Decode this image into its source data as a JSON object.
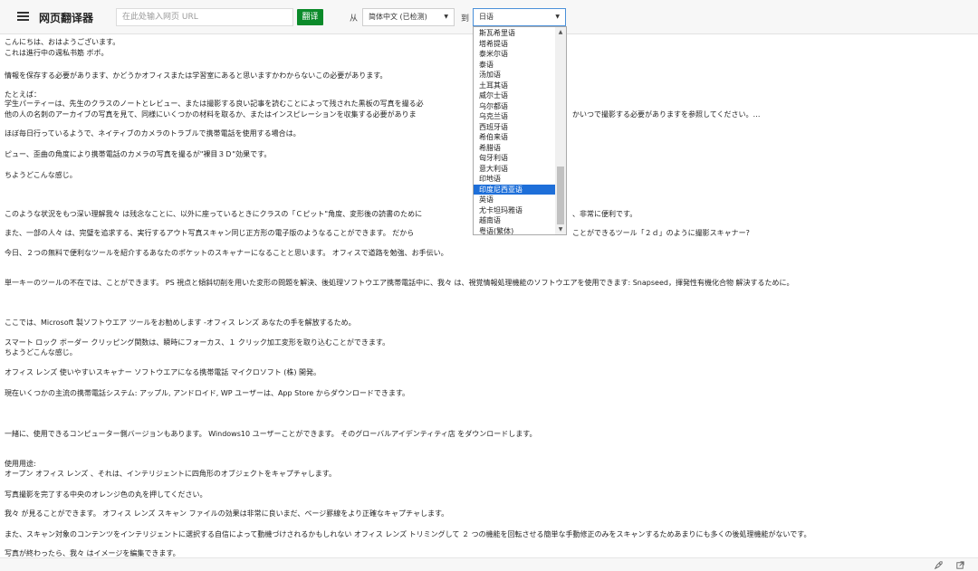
{
  "header": {
    "app_title": "网页翻译器",
    "url_placeholder": "在此处输入网页 URL",
    "translate_label": "翻译",
    "from_label": "从",
    "from_value": "简体中文 (已检测)",
    "to_label": "到",
    "to_value": "日语"
  },
  "dropdown": {
    "options": [
      "斯瓦希里语",
      "塔希提语",
      "泰米尔语",
      "泰语",
      "汤加语",
      "土耳其语",
      "威尔士语",
      "乌尔都语",
      "乌克兰语",
      "西班牙语",
      "希伯来语",
      "希腊语",
      "匈牙利语",
      "意大利语",
      "印地语",
      "印度尼西亚语",
      "英语",
      "尤卡坦玛雅语",
      "越南语",
      "粤语(繁体)"
    ],
    "selected": "印度尼西亚语"
  },
  "content": {
    "lines": [
      "こんにちは、おはようございます。",
      "これは進行中の週私书筋 ボボ。",
      "情報を保存する必要があります、かどうかオフィスまたは学習室にあると思いますかわからないこの必要があります。",
      "たとえば：",
      "学生パーティーは、先生のクラスのノートとレビュー、または撮影する良い記事を読むことによって残された黒板の写真を撮る必",
      "他の人の名刺のアーカイブの写真を見て、同様にいくつかの材料を取るか、またはインスピレーションを収集する必要がありま",
      "かいつで撮影する必要がありますを参照してください。…",
      "ほぼ毎日行っているようで、ネイティブのカメラのトラブルで携帯電話を使用する場合は。",
      "ピュー、歪曲の角度により携帯電話のカメラの写真を撮るが\"裸目３Ｄ\"効果です。",
      "ちようどこんな感じ。",
      "このような状況をもつ深い理解我々 は残念なことに、以外に座っているときにクラスの「Ｃピット\"角度、変形後の読書のために",
      "、非常に便利です。",
      "また、一部の人々 は、完璧を追求する、実行するアウト写真スキャン同じ正方形の電子版のようなることができます。 だから",
      "ことができるツール「２ｄ」のように撮影スキャナー?",
      "今日、２つの無料で便利なツールを紹介するあなたのポケットのスキャナーになることと思います。 オフィスで道路を勉強、お手伝い。",
      "単一キーのツールの不在では、ことができます。 PS 視点と傾斜切削を用いた変形の問題を解決、後処理ソフトウエア携帯電話中に、我々 は、視覚情報処理機能のソフトウエアを使用できます: Snapseed，揮発性有機化合物 解決するために。",
      "ここでは、Microsoft 製ソフトウエア ツールをお勧めします -オフィス レンズ あなたの手を解放するため。",
      "スマート ロック ボーダー クリッピング関数は、瞬時にフォーカス、１ クリック加工変形を取り込むことができます。",
      "ちようどこんな感じ。",
      "オフィス レンズ 使いやすいスキャナー ソフトウエアになる携帯電話 マイクロソフト (株) 開発。",
      "現在いくつかの主流の携帯電話システム: アップル, アンドロイド, WP ユーザーは、App Store からダウンロードできます。",
      "一緒に、使用できるコンピューター側バージョンもあります。 Windows10 ユーザーことができます。 そのグローバルアイデンティティ店 をダウンロードします。",
      "使用用途:",
      "オープン オフィス レンズ 、それは、インテリジェントに四角形のオブジェクトをキャプチャします。",
      "写真撮影を完了する中央のオレンジ色の丸を押してください。",
      "我々 が見ることができます。 オフィス レンズ スキャン ファイルの効果は非常に良いまだ、ページ罫線をより正確なキャプチャします。",
      "また、スキャン対象のコンテンツをインテリジェントに選択する自信によって動機づけされるかもしれない オフィス レンズ トリミングして ２ つの機能を回転させる簡単な手動修正のみをスキャンするためあまりにも多くの後処理機能がないです。",
      "写真が終わったら、我々 はイメージを編集できます。"
    ]
  },
  "status": {
    "icons": [
      "rocket-icon",
      "share-icon"
    ]
  }
}
